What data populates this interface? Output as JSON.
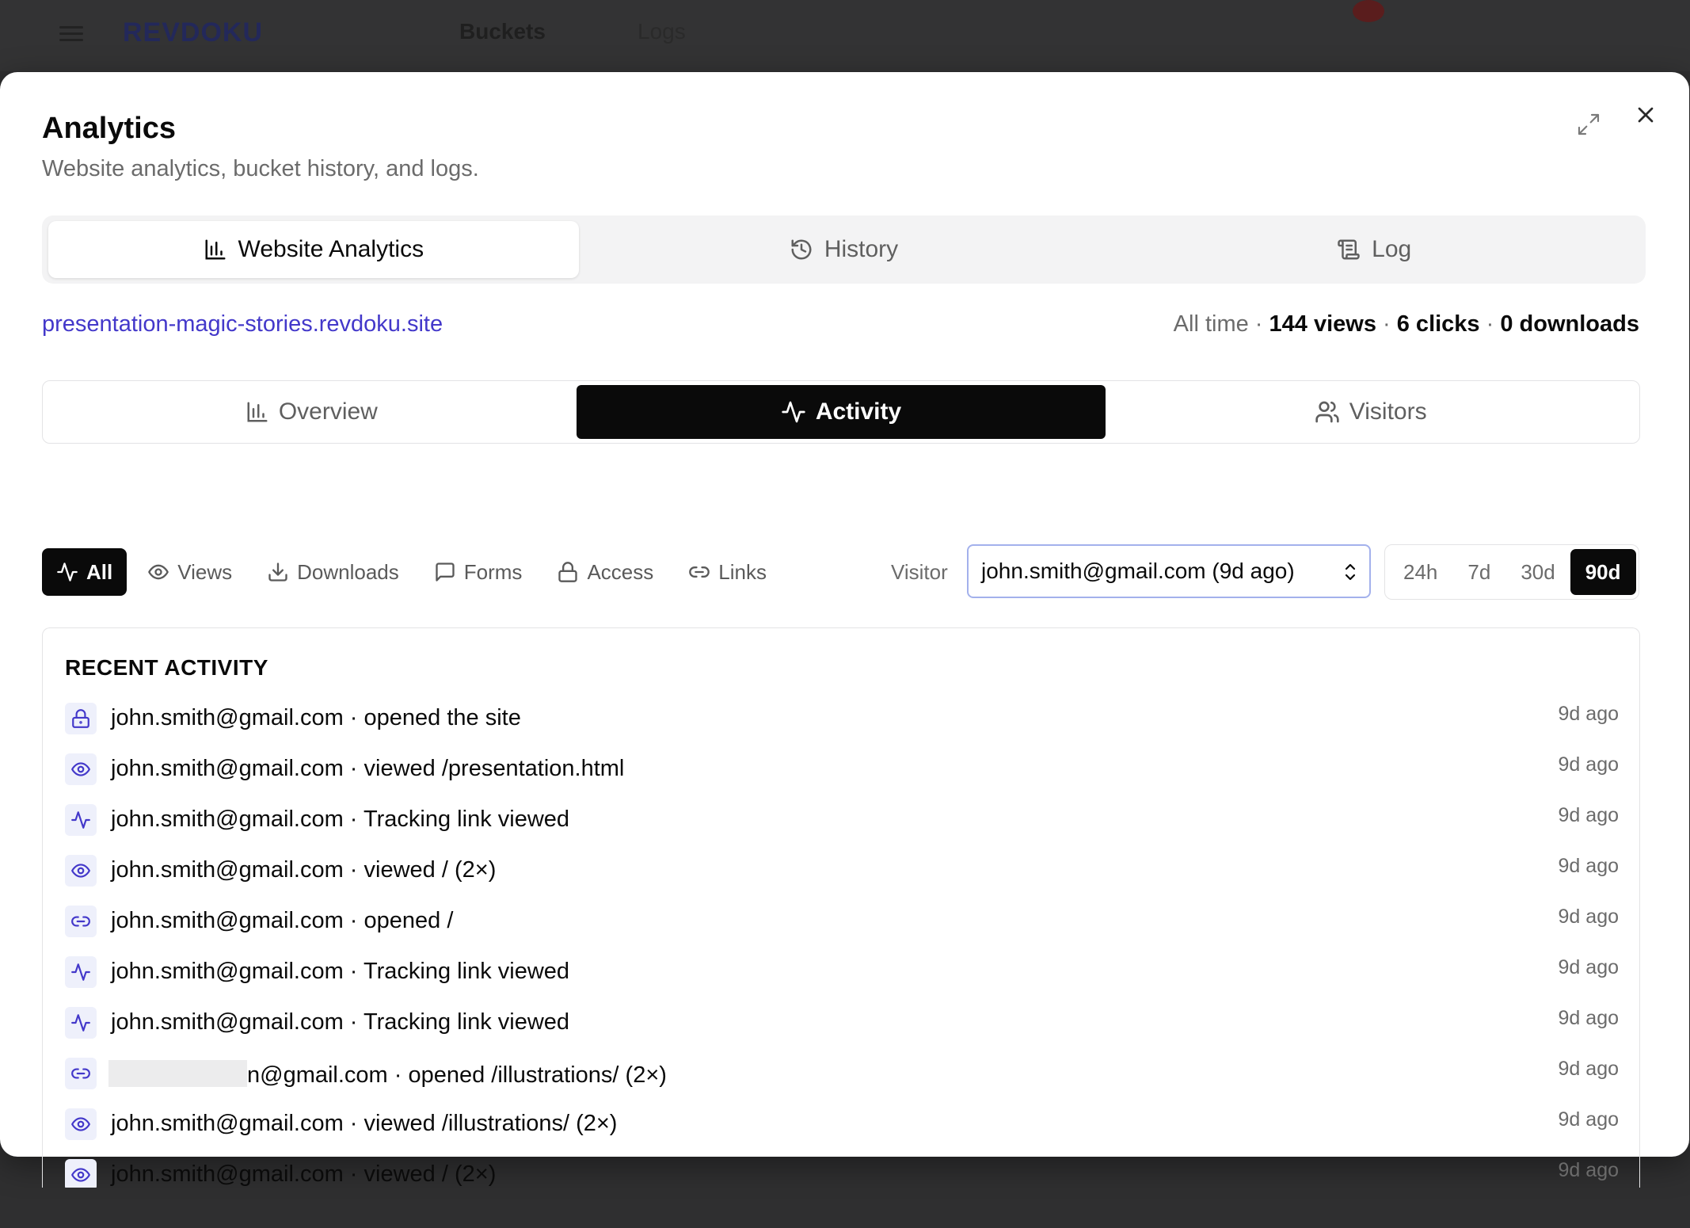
{
  "background": {
    "nav_buckets": "Buckets",
    "nav_logs": "Logs",
    "logo": "REVDOKU"
  },
  "modal": {
    "title": "Analytics",
    "subtitle": "Website analytics, bucket history, and logs."
  },
  "top_tabs": [
    {
      "label": "Website Analytics",
      "icon": "bar-chart-icon",
      "active": true
    },
    {
      "label": "History",
      "icon": "history-icon",
      "active": false
    },
    {
      "label": "Log",
      "icon": "scroll-icon",
      "active": false
    }
  ],
  "site": {
    "url": "presentation-magic-stories.revdoku.site"
  },
  "stats": {
    "prefix": "All time · ",
    "views": "144 views",
    "clicks": "6 clicks",
    "downloads": "0 downloads",
    "sep": " · "
  },
  "sub_tabs": [
    {
      "label": "Overview",
      "icon": "bar-chart-icon",
      "active": false
    },
    {
      "label": "Activity",
      "icon": "activity-icon",
      "active": true
    },
    {
      "label": "Visitors",
      "icon": "users-icon",
      "active": false
    }
  ],
  "filters": [
    {
      "label": "All",
      "icon": "activity-icon",
      "active": true
    },
    {
      "label": "Views",
      "icon": "eye-icon",
      "active": false
    },
    {
      "label": "Downloads",
      "icon": "download-icon",
      "active": false
    },
    {
      "label": "Forms",
      "icon": "message-icon",
      "active": false
    },
    {
      "label": "Access",
      "icon": "lock-icon",
      "active": false
    },
    {
      "label": "Links",
      "icon": "link-icon",
      "active": false
    }
  ],
  "visitor": {
    "label": "Visitor",
    "selected": "john.smith@gmail.com (9d ago)"
  },
  "ranges": [
    {
      "label": "24h",
      "active": false
    },
    {
      "label": "7d",
      "active": false
    },
    {
      "label": "30d",
      "active": false
    },
    {
      "label": "90d",
      "active": true
    }
  ],
  "recent_activity": {
    "title": "RECENT ACTIVITY",
    "items": [
      {
        "icon": "lock-icon",
        "text": "john.smith@gmail.com · opened the site",
        "time": "9d ago"
      },
      {
        "icon": "eye-icon",
        "text": "john.smith@gmail.com · viewed /presentation.html",
        "time": "9d ago"
      },
      {
        "icon": "activity-icon",
        "text": "john.smith@gmail.com · Tracking link viewed",
        "time": "9d ago"
      },
      {
        "icon": "eye-icon",
        "text": "john.smith@gmail.com · viewed / (2×)",
        "time": "9d ago"
      },
      {
        "icon": "link-icon",
        "text": "john.smith@gmail.com · opened /",
        "time": "9d ago"
      },
      {
        "icon": "activity-icon",
        "text": "john.smith@gmail.com · Tracking link viewed",
        "time": "9d ago"
      },
      {
        "icon": "activity-icon",
        "text": "john.smith@gmail.com · Tracking link viewed",
        "time": "9d ago"
      },
      {
        "icon": "link-icon",
        "text": "n@gmail.com · opened /illustrations/ (2×)",
        "time": "9d ago",
        "redacted_prefix": true
      },
      {
        "icon": "eye-icon",
        "text": "john.smith@gmail.com · viewed /illustrations/ (2×)",
        "time": "9d ago"
      },
      {
        "icon": "eye-icon",
        "text": "john.smith@gmail.com · viewed / (2×)",
        "time": "9d ago"
      }
    ]
  },
  "colors": {
    "accent": "#4338ca",
    "icon_bg": "#eef0fb",
    "active_dark": "#0a0a0a"
  }
}
